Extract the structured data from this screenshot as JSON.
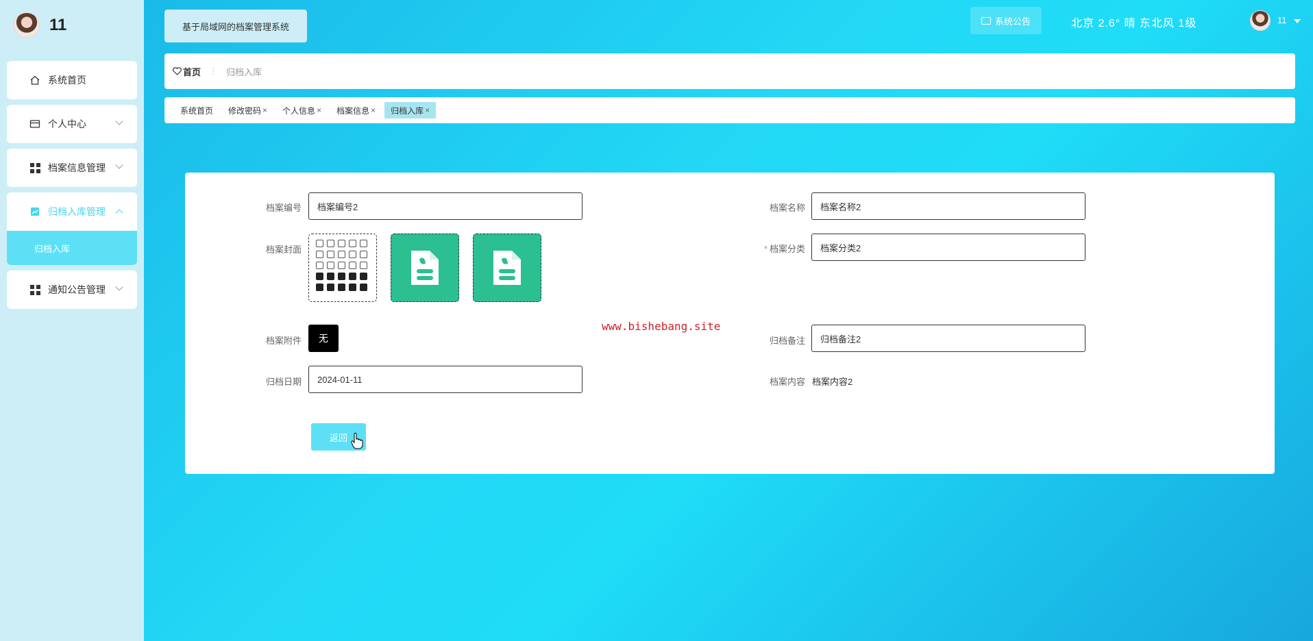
{
  "user": {
    "name": "11"
  },
  "sidebar": {
    "items": [
      {
        "label": "系统首页",
        "icon": "home-icon"
      },
      {
        "label": "个人中心",
        "icon": "card-icon"
      },
      {
        "label": "档案信息管理",
        "icon": "grid-icon"
      },
      {
        "label": "归档入库管理",
        "icon": "chart-icon"
      },
      {
        "label": "通知公告管理",
        "icon": "grid-icon"
      }
    ],
    "submenu_label": "归档入库"
  },
  "header": {
    "system_title": "基于局域网的档案管理系统",
    "notice_label": "系统公告",
    "weather": "北京 2.6° 晴 东北风 1级",
    "user": "11"
  },
  "breadcrumb": {
    "home": "首页",
    "current": "归档入库"
  },
  "tabs": [
    {
      "label": "系统首页",
      "closable": false
    },
    {
      "label": "修改密码",
      "closable": true
    },
    {
      "label": "个人信息",
      "closable": true
    },
    {
      "label": "档案信息",
      "closable": true
    },
    {
      "label": "归档入库",
      "closable": true
    }
  ],
  "form": {
    "archive_no_label": "档案编号",
    "archive_no_value": "档案编号2",
    "archive_name_label": "档案名称",
    "archive_name_value": "档案名称2",
    "cover_label": "档案封面",
    "category_label": "档案分类",
    "category_required_mark": "*",
    "category_value": "档案分类2",
    "attachment_label": "档案附件",
    "attachment_value": "无",
    "remark_label": "归档备注",
    "remark_value": "归档备注2",
    "date_label": "归档日期",
    "date_value": "2024-01-11",
    "content_label": "档案内容",
    "content_value": "档案内容2",
    "back_label": "返回"
  },
  "watermark": "www.bishebang.site",
  "colors": {
    "accent": "#5de0f5",
    "sidebar_bg": "#cdeef7",
    "cover_green": "#2bbf91"
  }
}
